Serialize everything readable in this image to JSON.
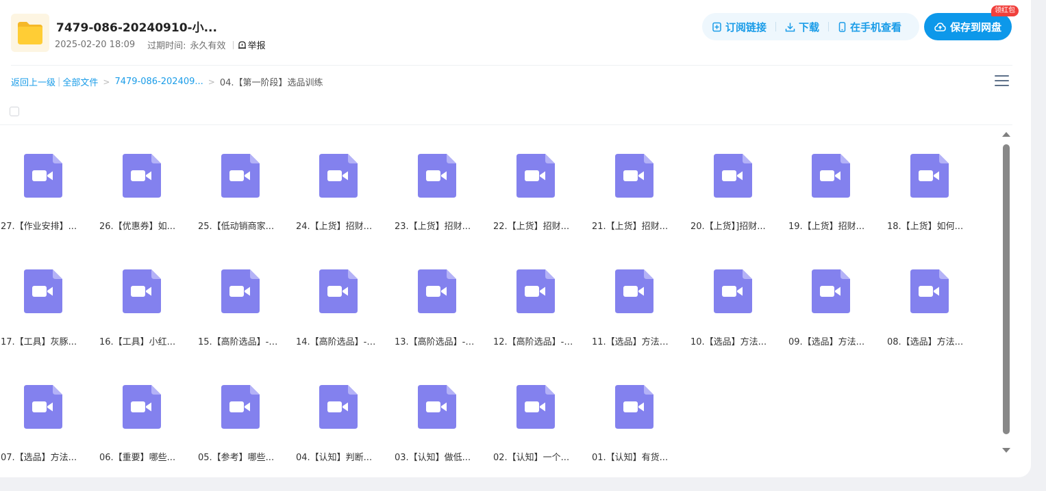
{
  "header": {
    "title": "7479-086-20240910-小...",
    "date": "2025-02-20 18:09",
    "expire_label": "过期时间:",
    "expire_value": "永久有效",
    "report_label": "举报"
  },
  "actions": {
    "subscribe_label": "订阅链接",
    "download_label": "下载",
    "mobile_label": "在手机查看",
    "save_label": "保存到网盘",
    "badge_label": "领红包"
  },
  "breadcrumb": {
    "back_label": "返回上一级",
    "all_files_label": "全部文件",
    "folder_label": "7479-086-202409...",
    "current_label": "04.【第一阶段】选品训练"
  },
  "colors": {
    "accent": "#1a9ce8",
    "primary_button": "#0d98ea",
    "video_icon": "#8381ee",
    "badge": "#f1403c"
  },
  "files": [
    {
      "name": "27.【作业安排】...",
      "icon": "video-file-icon"
    },
    {
      "name": "26.【优惠券】如...",
      "icon": "video-file-icon"
    },
    {
      "name": "25.【低动销商家...",
      "icon": "video-file-icon"
    },
    {
      "name": "24.【上货】招财...",
      "icon": "video-file-icon"
    },
    {
      "name": "23.【上货】招财...",
      "icon": "video-file-icon"
    },
    {
      "name": "22.【上货】招财...",
      "icon": "video-file-icon"
    },
    {
      "name": "21.【上货】招财...",
      "icon": "video-file-icon"
    },
    {
      "name": "20.【上货】]招财...",
      "icon": "video-file-icon"
    },
    {
      "name": "19.【上货】招财...",
      "icon": "video-file-icon"
    },
    {
      "name": "18.【上货】如何...",
      "icon": "video-file-icon"
    },
    {
      "name": "17.【工具】灰豚...",
      "icon": "video-file-icon"
    },
    {
      "name": "16.【工具】小红...",
      "icon": "video-file-icon"
    },
    {
      "name": "15.【高阶选品】--...",
      "icon": "video-file-icon"
    },
    {
      "name": "14.【高阶选品】--...",
      "icon": "video-file-icon"
    },
    {
      "name": "13.【高阶选品】--...",
      "icon": "video-file-icon"
    },
    {
      "name": "12.【高阶选品】--...",
      "icon": "video-file-icon"
    },
    {
      "name": "11.【选品】方法五...",
      "icon": "video-file-icon"
    },
    {
      "name": "10.【选品】方法...",
      "icon": "video-file-icon"
    },
    {
      "name": "09.【选品】方法...",
      "icon": "video-file-icon"
    },
    {
      "name": "08.【选品】方法...",
      "icon": "video-file-icon"
    },
    {
      "name": "07.【选品】方法...",
      "icon": "video-file-icon"
    },
    {
      "name": "06.【重要】哪些...",
      "icon": "video-file-icon"
    },
    {
      "name": "05.【参考】哪些...",
      "icon": "video-file-icon"
    },
    {
      "name": "04.【认知】判断...",
      "icon": "video-file-icon"
    },
    {
      "name": "03.【认知】做低...",
      "icon": "video-file-icon"
    },
    {
      "name": "02.【认知】一个...",
      "icon": "video-file-icon"
    },
    {
      "name": "01.【认知】有货...",
      "icon": "video-file-icon"
    }
  ]
}
